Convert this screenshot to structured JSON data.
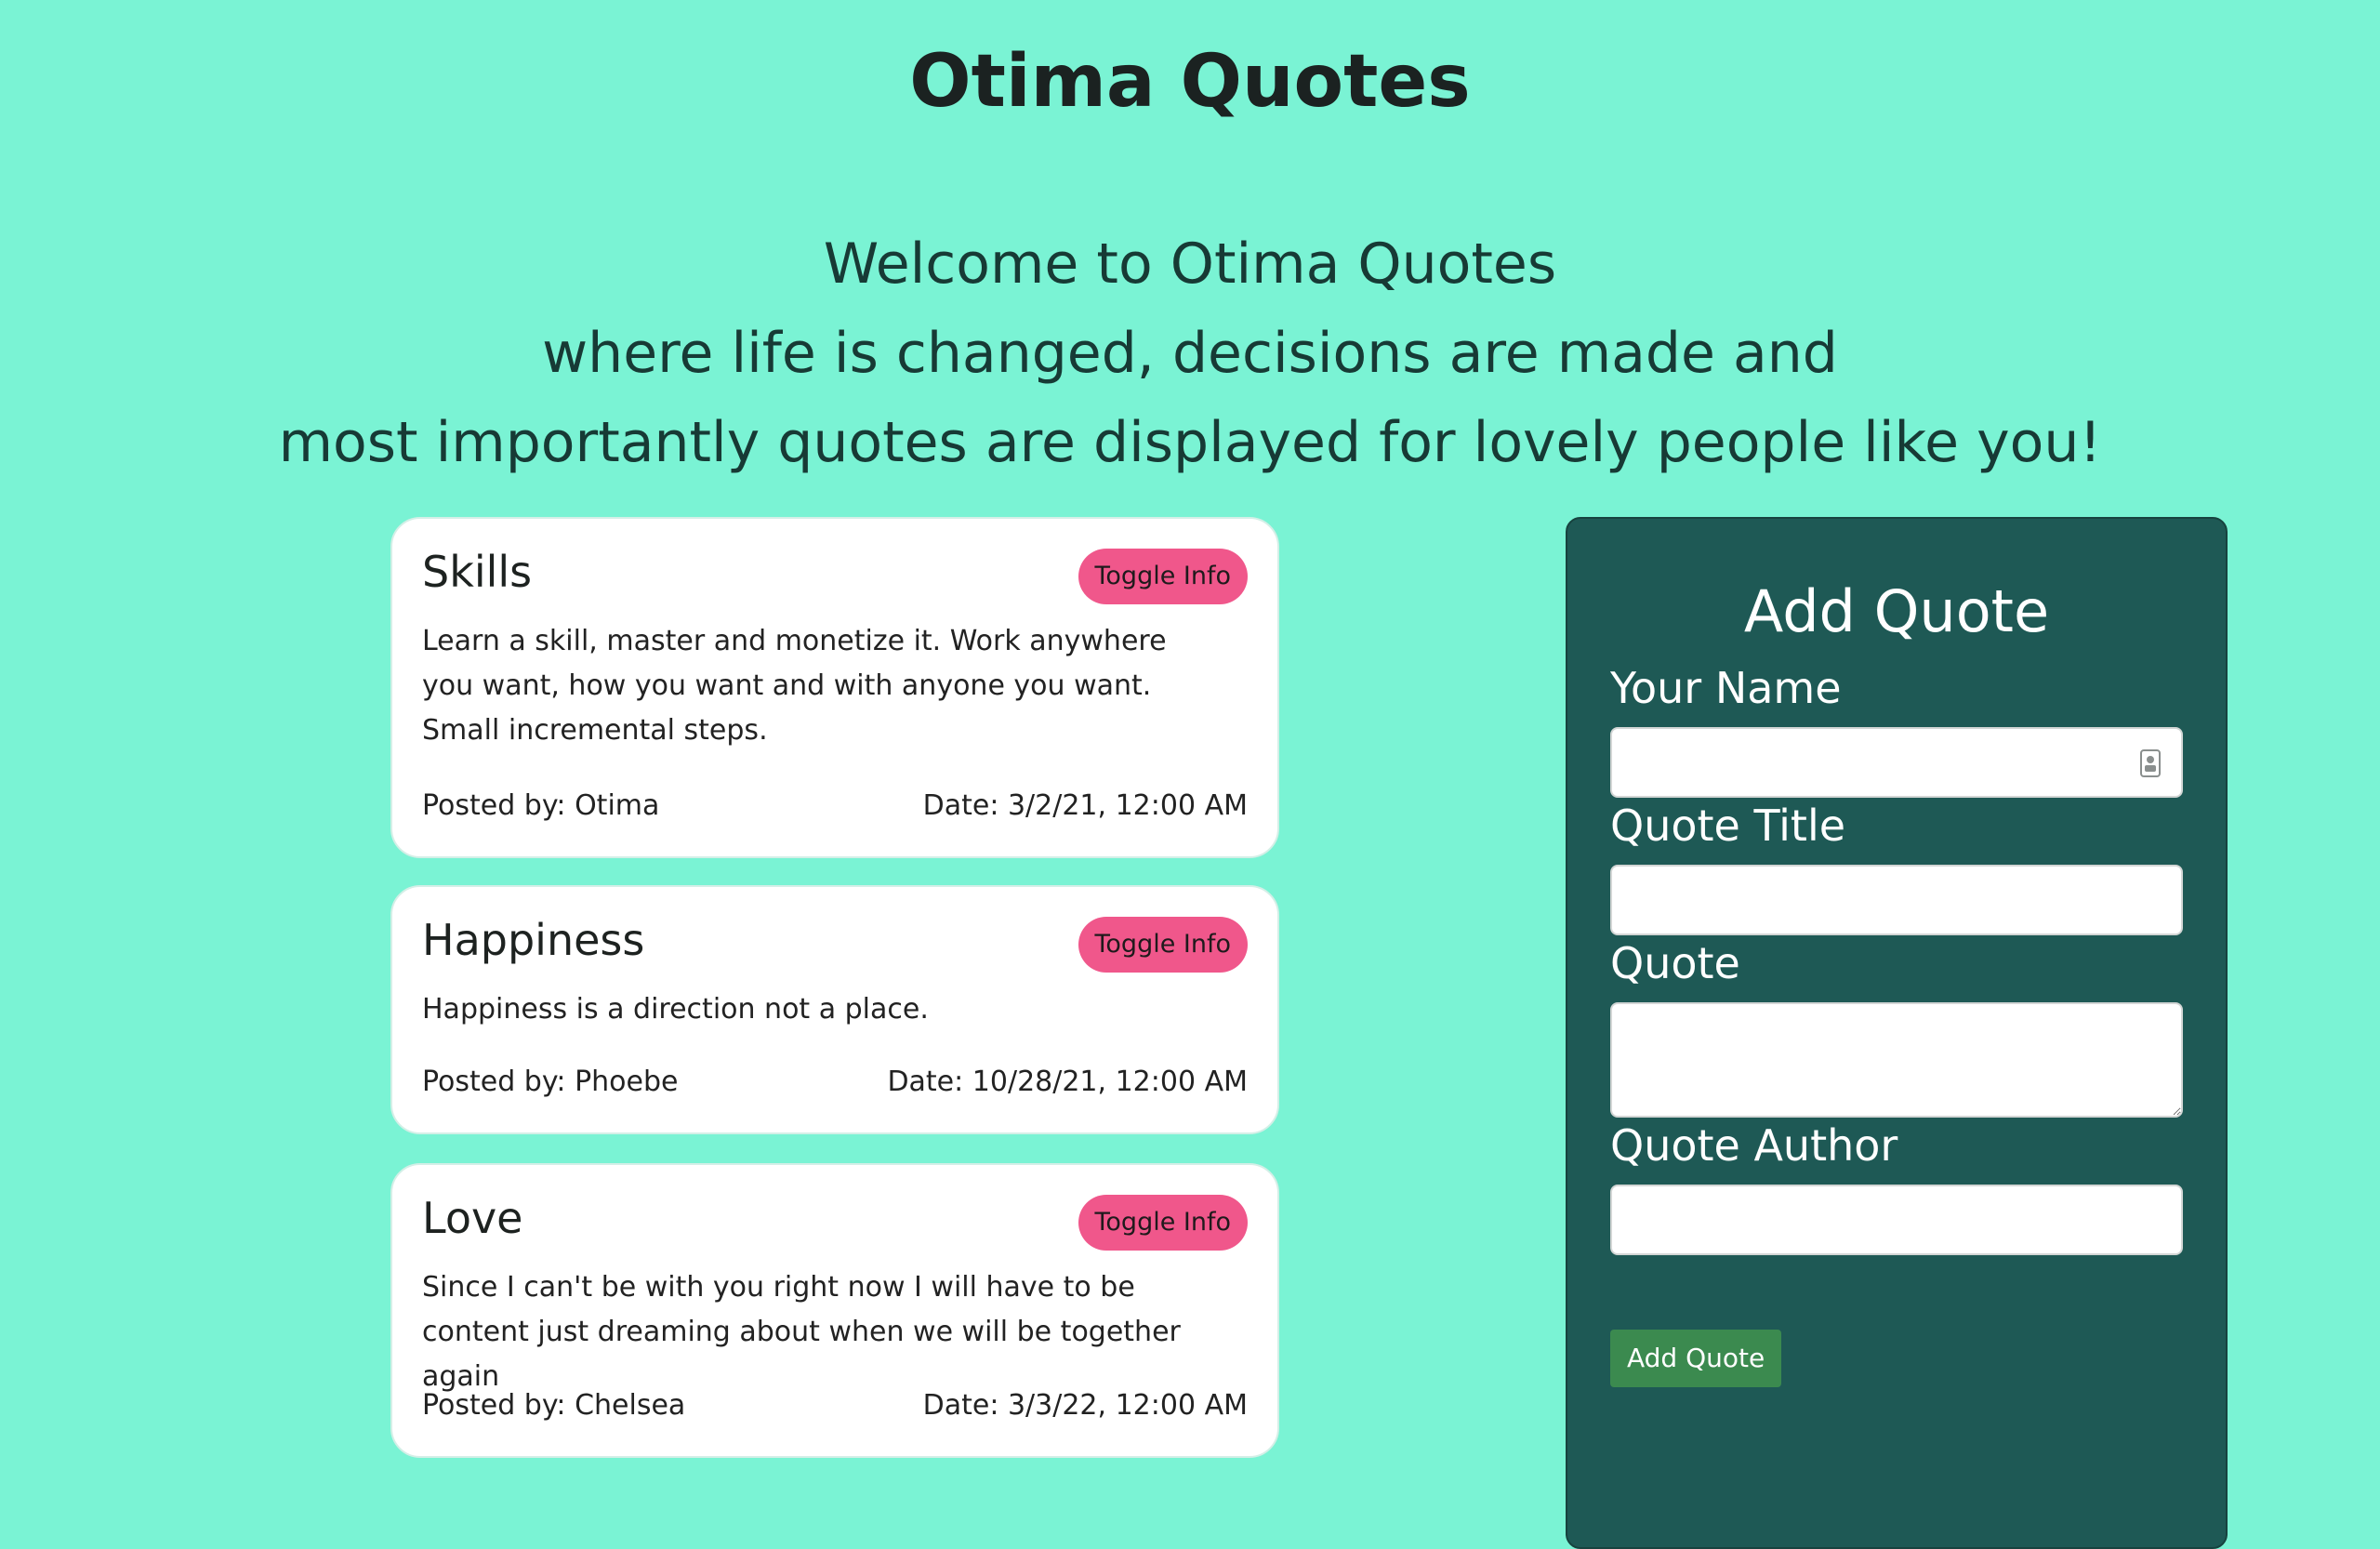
{
  "header": {
    "title": "Otima Quotes",
    "welcome_lines": [
      "Welcome to Otima Quotes",
      "where life is changed, decisions are made and",
      "most importantly quotes are displayed for lovely people like you!"
    ]
  },
  "quotes": [
    {
      "title": "Skills",
      "toggle_label": "Toggle Info",
      "body": "Learn a skill, master and monetize it. Work anywhere you want, how you want and with anyone you want. Small incremental steps.",
      "posted_by": "Posted by: Otima",
      "date": "Date: 3/2/21, 12:00 AM"
    },
    {
      "title": "Happiness",
      "toggle_label": "Toggle Info",
      "body": "Happiness is a direction not a place.",
      "posted_by": "Posted by: Phoebe",
      "date": "Date: 10/28/21, 12:00 AM"
    },
    {
      "title": "Love",
      "toggle_label": "Toggle Info",
      "body": "Since I can't be with you right now I will have to be content just dreaming about when we will be together again",
      "posted_by": "Posted by: Chelsea",
      "date": "Date: 3/3/22, 12:00 AM"
    }
  ],
  "form": {
    "heading": "Add Quote",
    "name_label": "Your Name",
    "name_value": "",
    "title_label": "Quote Title",
    "title_value": "",
    "quote_label": "Quote",
    "quote_value": "",
    "author_label": "Quote Author",
    "author_value": "",
    "submit_label": "Add Quote",
    "name_field_icon": "contact-card-icon"
  },
  "colors": {
    "background": "#7af3d4",
    "panel": "#1e5955",
    "toggle_button": "#f0578b",
    "submit_button": "#3b8a4f"
  }
}
